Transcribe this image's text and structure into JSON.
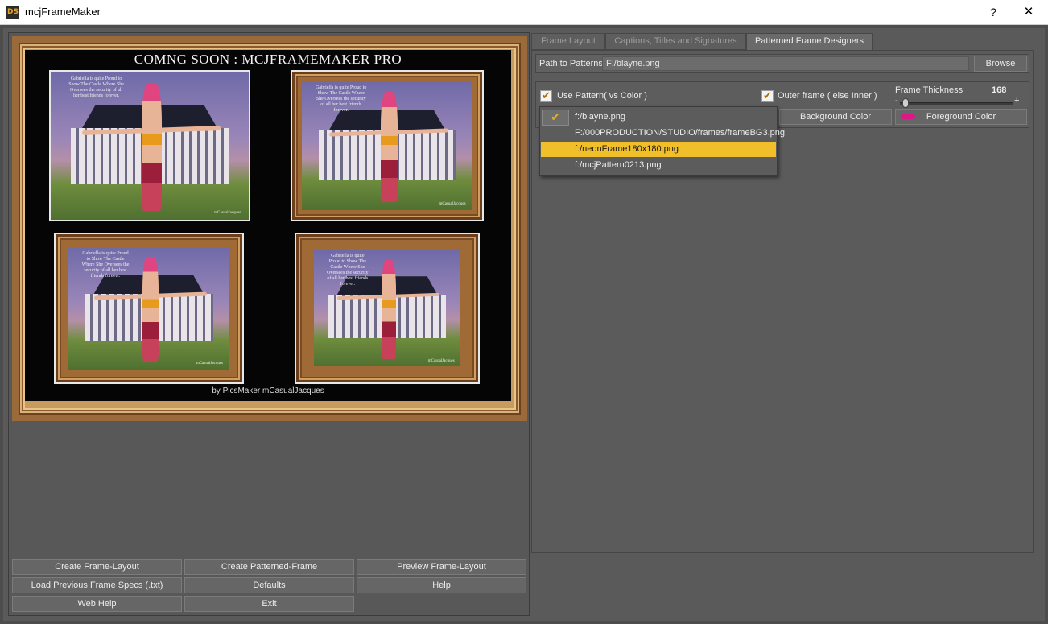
{
  "window": {
    "title": "mcjFrameMaker",
    "app_icon": "DS",
    "help": "?",
    "close": "✕"
  },
  "preview": {
    "title": "COMNG SOON : MCJFRAMEMAKER PRO",
    "credit": "by PicsMaker mCasualJacques",
    "thumb_caption": "Gabriella is quite Proud to Show The Castle Where She Oversees the security of all her best friends forever.",
    "thumb_signature": "mCasualJacques",
    "thumbnails": [
      "plain",
      "framed",
      "framed",
      "framed"
    ]
  },
  "buttons": {
    "create_layout": "Create Frame-Layout",
    "create_patterned": "Create Patterned-Frame",
    "preview_layout": "Preview Frame-Layout",
    "load_previous": "Load Previous Frame Specs (.txt)",
    "defaults": "Defaults",
    "help": "Help",
    "web_help": "Web Help",
    "exit": "Exit"
  },
  "tabs": [
    {
      "label": "Frame Layout",
      "active": false
    },
    {
      "label": "Captions, Titles and Signatures",
      "active": false
    },
    {
      "label": "Patterned Frame Designers",
      "active": true
    }
  ],
  "patterns": {
    "path_label": "Path to Patterns",
    "path_value": "F:/blayne.png",
    "browse": "Browse",
    "use_pattern_label": "Use Pattern( vs Color )",
    "use_pattern_checked": true,
    "outer_frame_label": "Outer frame ( else Inner )",
    "outer_frame_checked": true,
    "thickness_label": "Frame Thickness",
    "thickness_value": "168",
    "thickness_fraction": 0.05,
    "slider_minus": "-",
    "slider_plus": "+",
    "background_color": "Background Color",
    "foreground_color": "Foreground Color",
    "foreground_swatch": "#e0158a"
  },
  "dropdown": {
    "items": [
      "f:/blayne.png",
      "F:/000PRODUCTION/STUDIO/frames/frameBG3.png",
      "f:/neonFrame180x180.png",
      "f:/mcjPattern0213.png"
    ],
    "selected_index": 2,
    "check_glyph": "✔"
  },
  "colors": {
    "accent": "#f0bf2a",
    "panel": "#5a5a5a"
  }
}
